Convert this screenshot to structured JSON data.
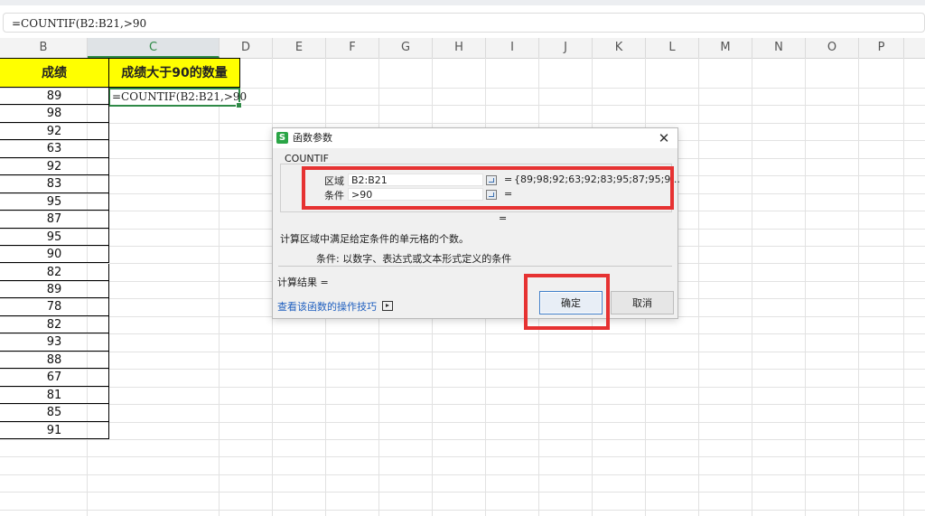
{
  "formula_bar": {
    "text": "=COUNTIF(B2:B21,>90"
  },
  "columns": [
    "B",
    "C",
    "D",
    "E",
    "F",
    "G",
    "H",
    "I",
    "J",
    "K",
    "L",
    "M",
    "N",
    "O",
    "P"
  ],
  "active_column": "C",
  "sheet": {
    "header_b": "成绩",
    "header_c": "成绩大于90的数量",
    "active_cell_text": "=COUNTIF(B2:B21,>90",
    "scores": [
      "89",
      "98",
      "92",
      "63",
      "92",
      "83",
      "95",
      "87",
      "95",
      "90",
      "82",
      "89",
      "78",
      "82",
      "93",
      "88",
      "67",
      "81",
      "85",
      "91"
    ]
  },
  "dialog": {
    "app_icon": "S",
    "title": "函数参数",
    "close_glyph": "✕",
    "function_name": "COUNTIF",
    "args": [
      {
        "label": "区域",
        "value": "B2:B21",
        "result": "{89;98;92;63;92;83;95;87;95;9..."
      },
      {
        "label": "条件",
        "value": ">90",
        "result": ""
      }
    ],
    "equals": "=",
    "description": "计算区域中满足给定条件的单元格的个数。",
    "param_description": "条件:  以数字、表达式或文本形式定义的条件",
    "calc_result": "计算结果 =",
    "help_link": "查看该函数的操作技巧",
    "ok_label": "确定",
    "cancel_label": "取消"
  },
  "colors": {
    "highlight": "#e63232",
    "header_fill": "#ffff00",
    "active": "#2f8a47"
  }
}
